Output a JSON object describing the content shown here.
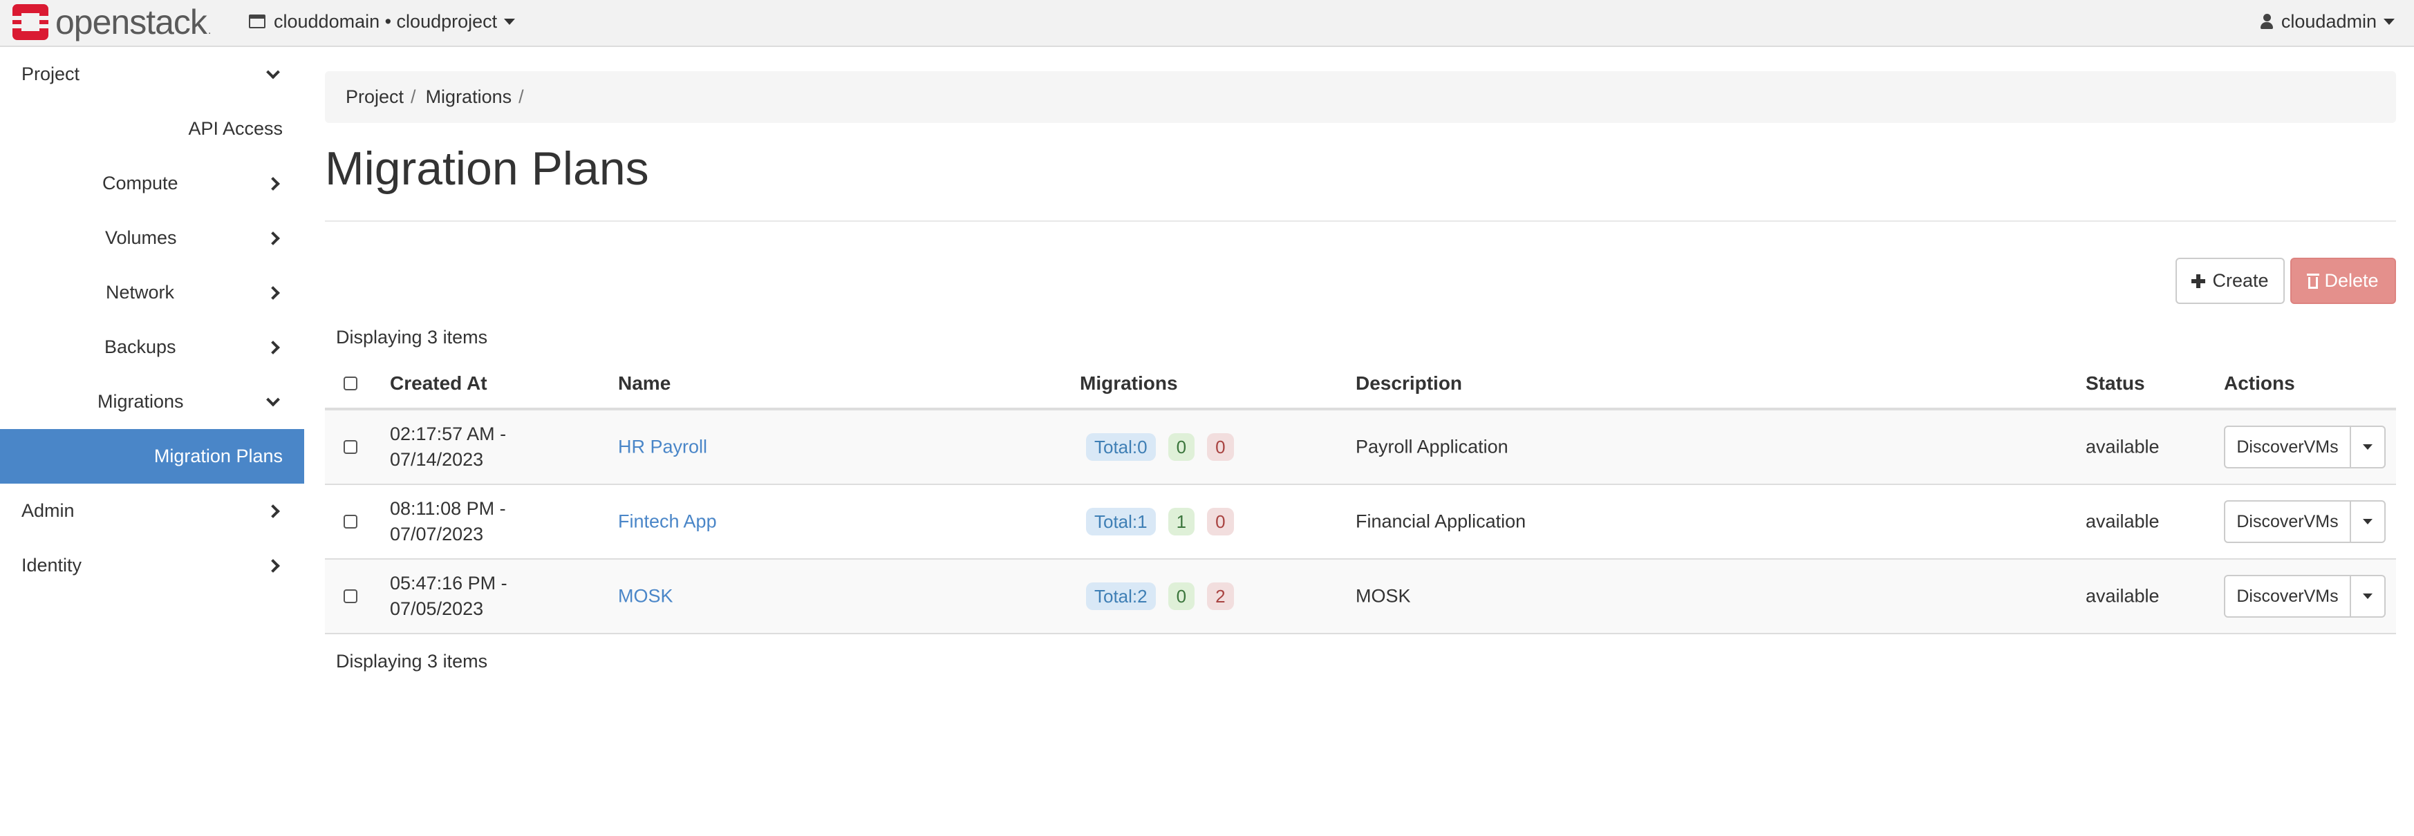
{
  "navbar": {
    "brand": "openstack",
    "brand_mark": ".",
    "context": "clouddomain • cloudproject",
    "user": "cloudadmin"
  },
  "sidebar": {
    "items": [
      {
        "label": "Project",
        "chevron": "down"
      },
      {
        "label": "API Access",
        "chevron": "none"
      },
      {
        "label": "Compute",
        "chevron": "right"
      },
      {
        "label": "Volumes",
        "chevron": "right"
      },
      {
        "label": "Network",
        "chevron": "right"
      },
      {
        "label": "Backups",
        "chevron": "right"
      },
      {
        "label": "Migrations",
        "chevron": "down"
      },
      {
        "label": "Migration Plans",
        "chevron": "none",
        "active": true
      },
      {
        "label": "Admin",
        "chevron": "right"
      },
      {
        "label": "Identity",
        "chevron": "right"
      }
    ]
  },
  "breadcrumb": {
    "items": [
      "Project",
      "Migrations"
    ],
    "separator": "/"
  },
  "page": {
    "title": "Migration Plans"
  },
  "toolbar": {
    "create_label": "Create",
    "delete_label": "Delete"
  },
  "table": {
    "display_count": "Displaying 3 items",
    "columns": [
      "Created At",
      "Name",
      "Migrations",
      "Description",
      "Status",
      "Actions"
    ],
    "rows": [
      {
        "created_time": "02:17:57 AM -",
        "created_date": "07/14/2023",
        "name": "HR Payroll",
        "total": "Total:0",
        "success": "0",
        "failed": "0",
        "description": "Payroll Application",
        "status": "available",
        "action": "DiscoverVMs"
      },
      {
        "created_time": "08:11:08 PM -",
        "created_date": "07/07/2023",
        "name": "Fintech App",
        "total": "Total:1",
        "success": "1",
        "failed": "0",
        "description": "Financial Application",
        "status": "available",
        "action": "DiscoverVMs"
      },
      {
        "created_time": "05:47:16 PM -",
        "created_date": "07/05/2023",
        "name": "MOSK",
        "total": "Total:2",
        "success": "0",
        "failed": "2",
        "description": "MOSK",
        "status": "available",
        "action": "DiscoverVMs"
      }
    ]
  },
  "colors": {
    "accent": "#4a86c8",
    "brand_red": "#da1a32",
    "delete_button": "#e4908c"
  }
}
